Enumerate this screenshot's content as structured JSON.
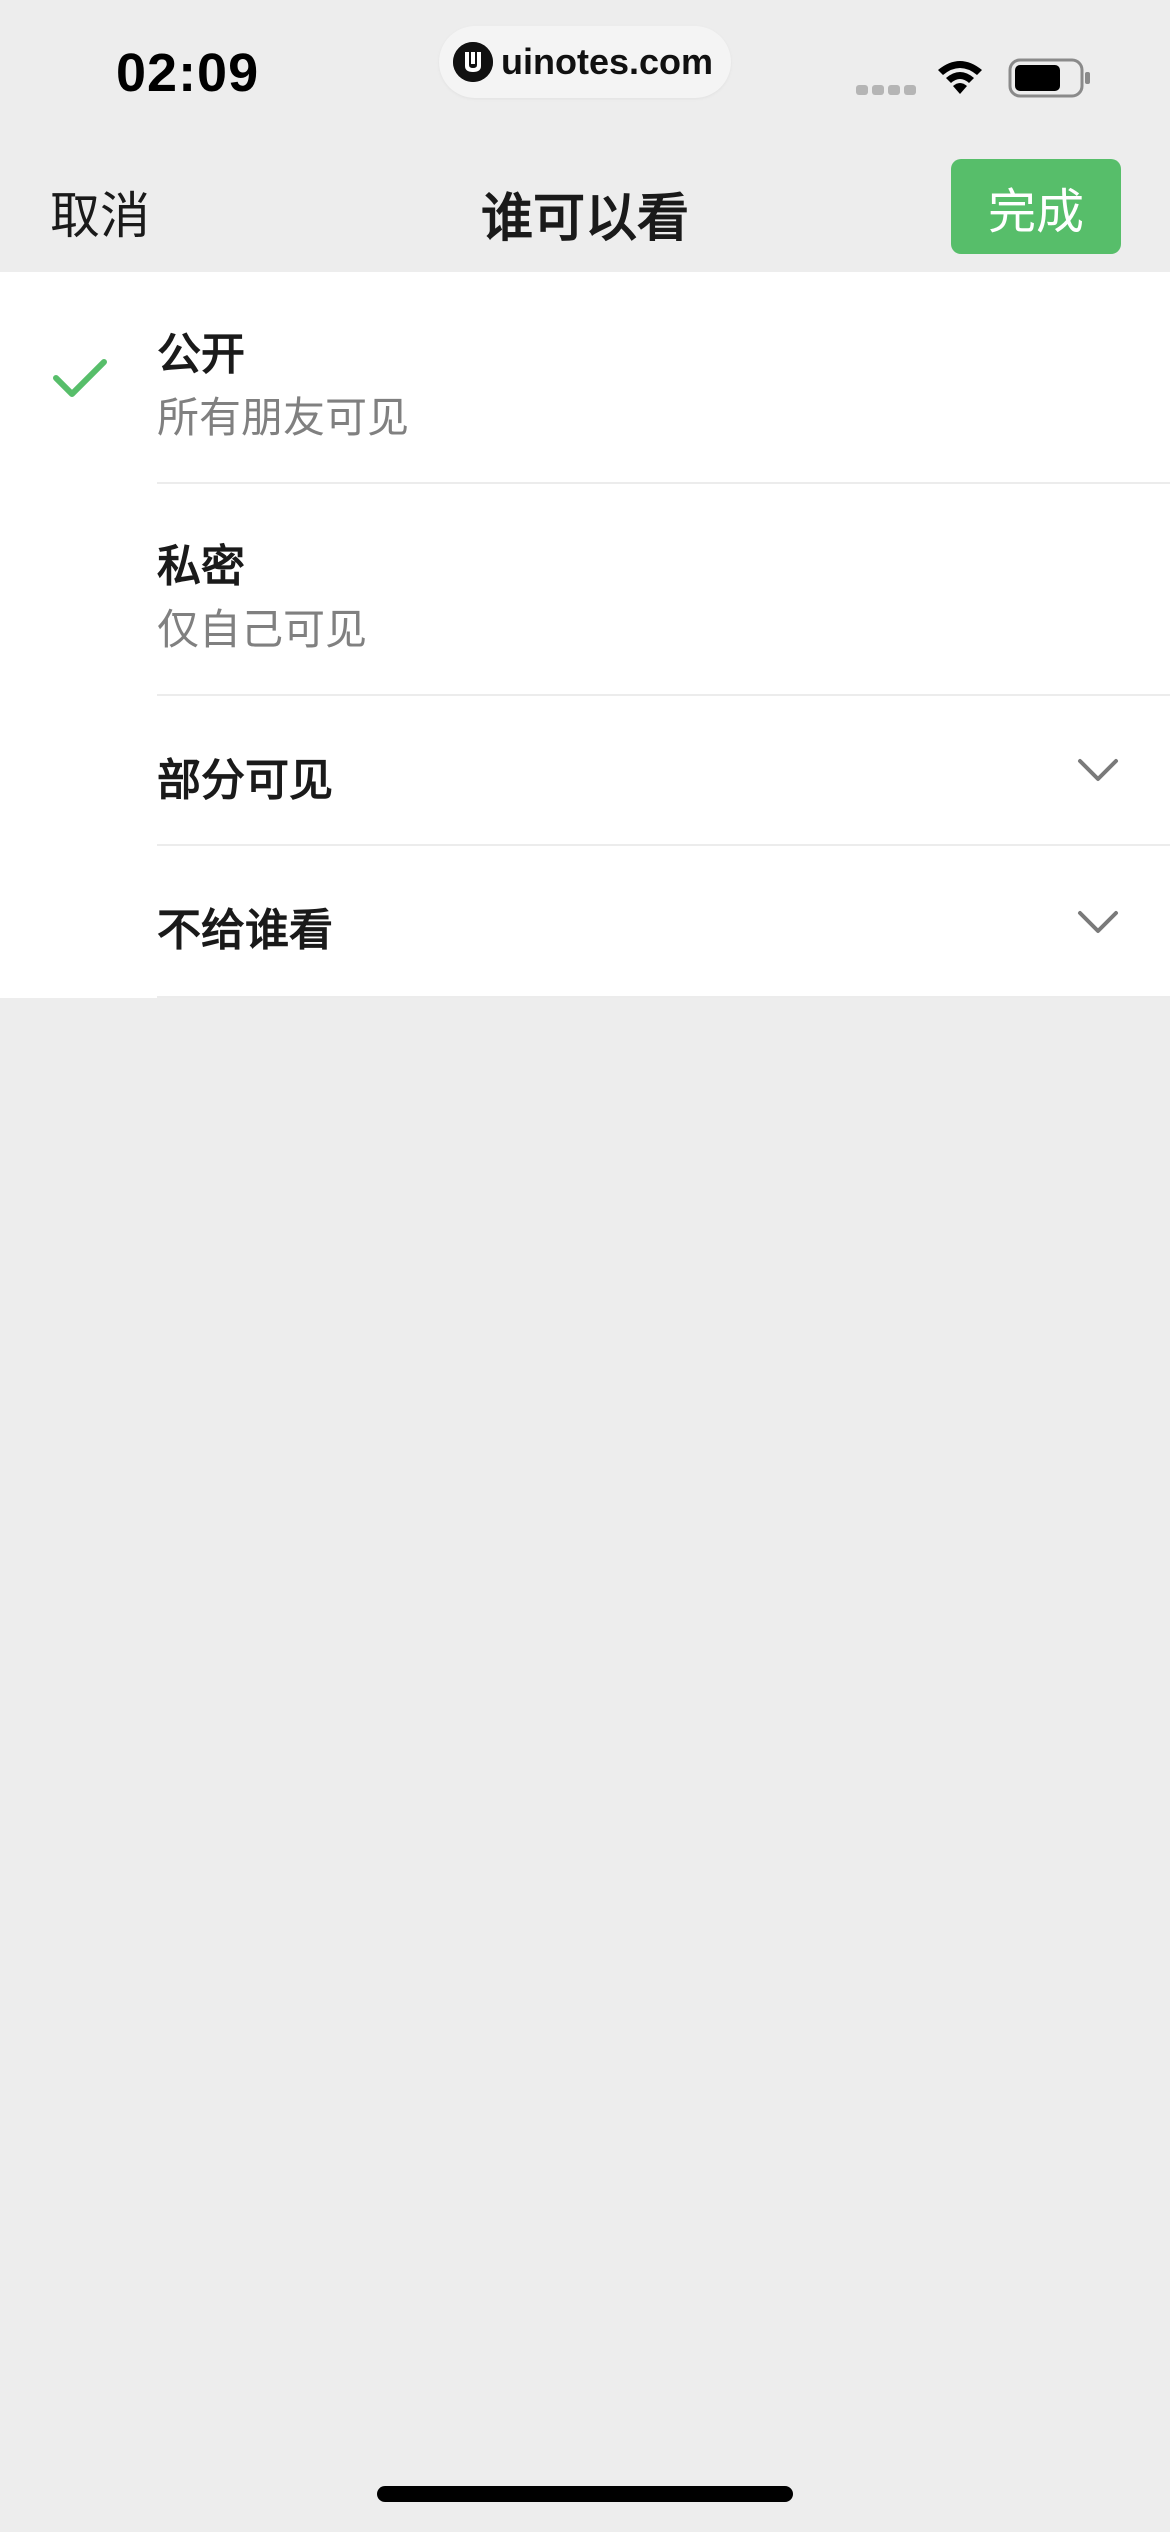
{
  "status_bar": {
    "time": "02:09",
    "url": "uinotes.com",
    "icons": [
      "signal-dots-icon",
      "wifi-icon",
      "battery-icon"
    ]
  },
  "nav": {
    "cancel_label": "取消",
    "title": "谁可以看",
    "done_label": "完成"
  },
  "options": [
    {
      "title": "公开",
      "subtitle": "所有朋友可见",
      "selected": true
    },
    {
      "title": "私密",
      "subtitle": "仅自己可见",
      "selected": false
    },
    {
      "title": "部分可见",
      "expandable": true,
      "selected": false
    },
    {
      "title": "不给谁看",
      "expandable": true,
      "selected": false
    }
  ],
  "colors": {
    "accent_green": "#57be6a",
    "background": "#ededed",
    "list_background": "#ffffff",
    "secondary_text": "#808080"
  }
}
